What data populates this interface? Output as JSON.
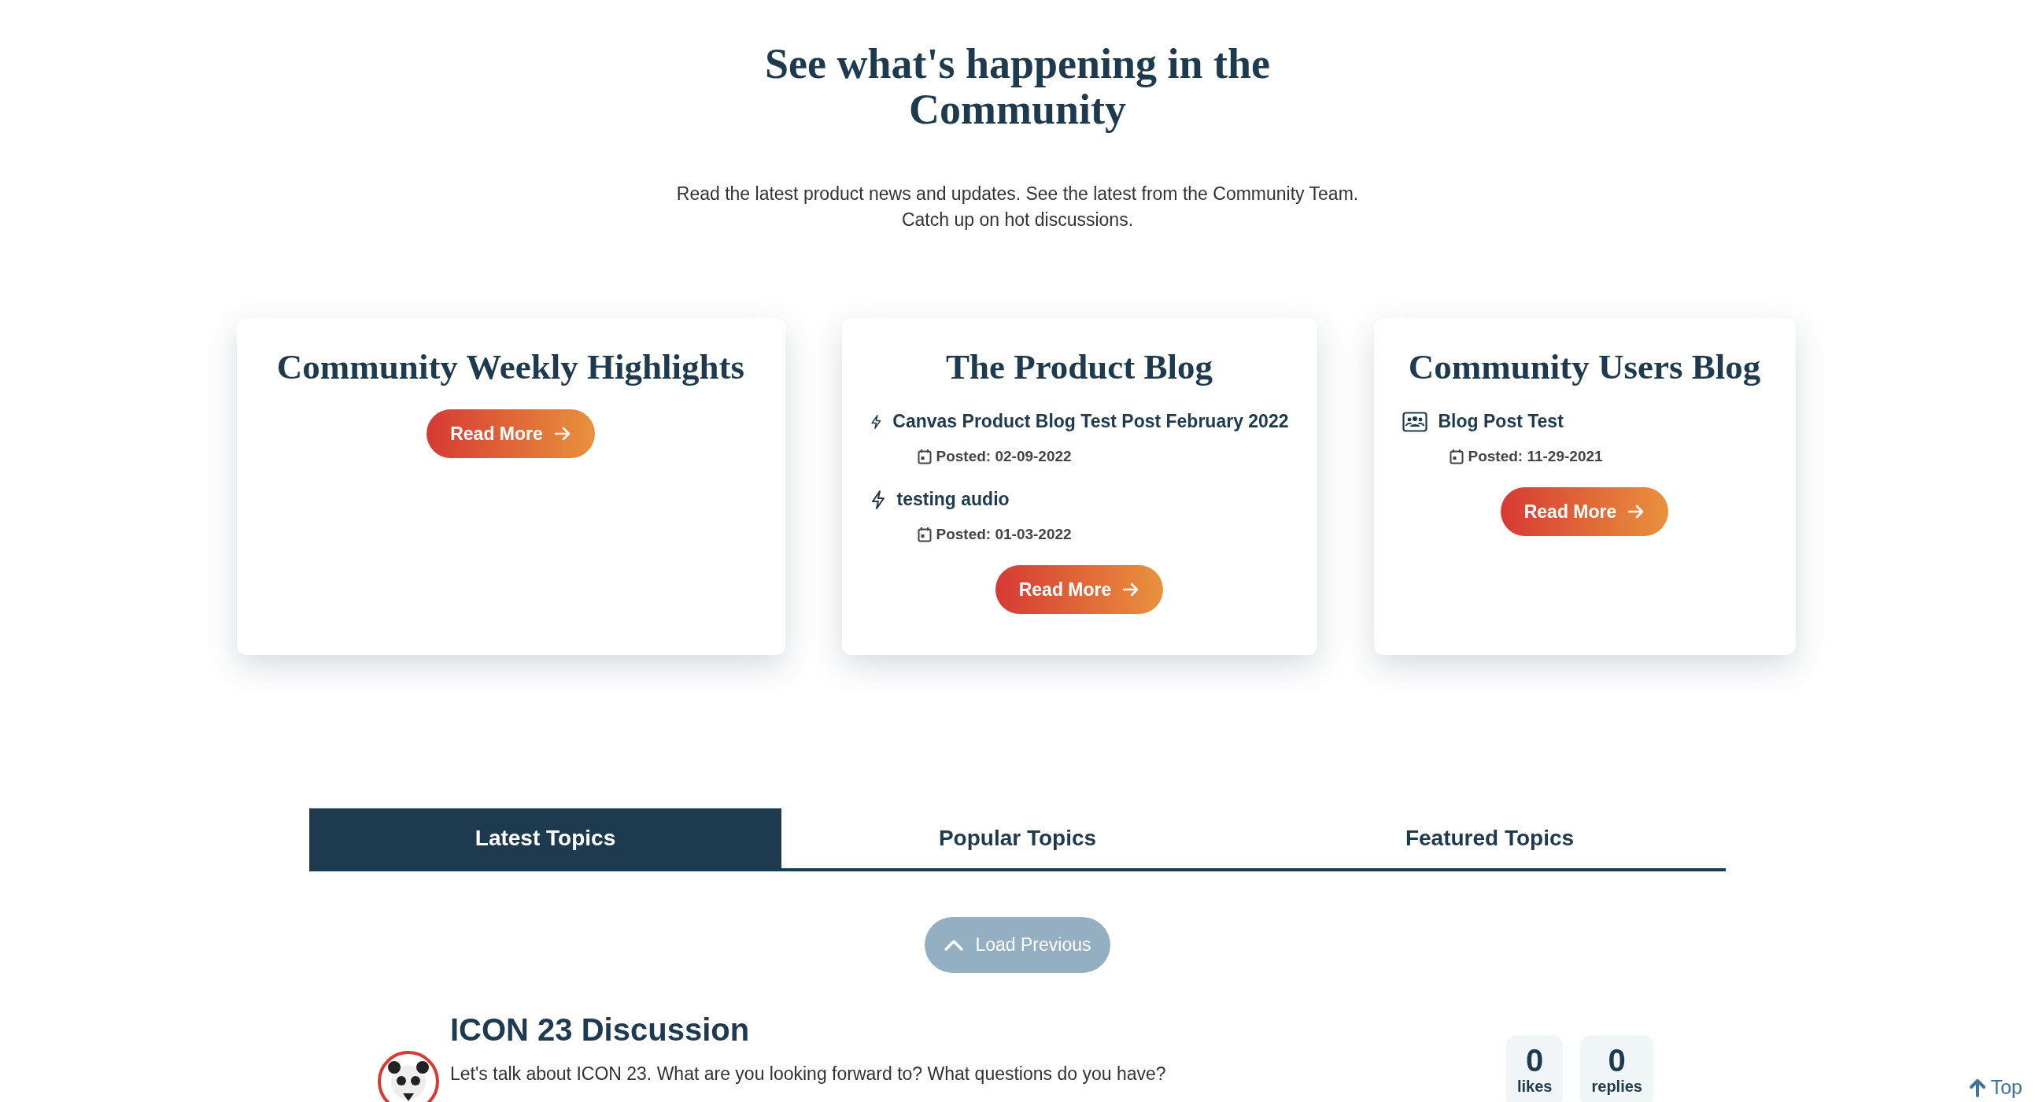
{
  "header": {
    "title_lines": [
      "See what's happening in the",
      "Community"
    ],
    "subtitle_lines": [
      "Read the latest product news and updates. See the latest from the Community Team.",
      "Catch up on hot discussions."
    ]
  },
  "cards": [
    {
      "title": "Community Weekly Highlights",
      "button": "Read More"
    },
    {
      "title": "The Product Blog",
      "posts": [
        {
          "kind": "bolt",
          "title": "Canvas Product Blog Test Post February 2022",
          "posted": "Posted: 02-09-2022"
        },
        {
          "kind": "bolt",
          "title": "testing audio",
          "posted": "Posted: 01-03-2022"
        }
      ],
      "button": "Read More"
    },
    {
      "title": "Community Users Blog",
      "posts": [
        {
          "kind": "group",
          "title": "Blog Post Test",
          "posted": "Posted: 11-29-2021"
        }
      ],
      "button": "Read More"
    }
  ],
  "tabs": [
    {
      "label": "Latest Topics",
      "selected": true
    },
    {
      "label": "Popular Topics",
      "selected": false
    },
    {
      "label": "Featured Topics",
      "selected": false
    }
  ],
  "load_previous": {
    "label": "Load Previous",
    "disabled": true
  },
  "topics": [
    {
      "title": "ICON 23 Discussion",
      "description": "Let's talk about ICON 23. What are you looking forward to? What questions do you have?",
      "likes": "0",
      "likes_label": "likes",
      "replies": "0",
      "replies_label": "replies"
    }
  ],
  "top_link": "Top"
}
